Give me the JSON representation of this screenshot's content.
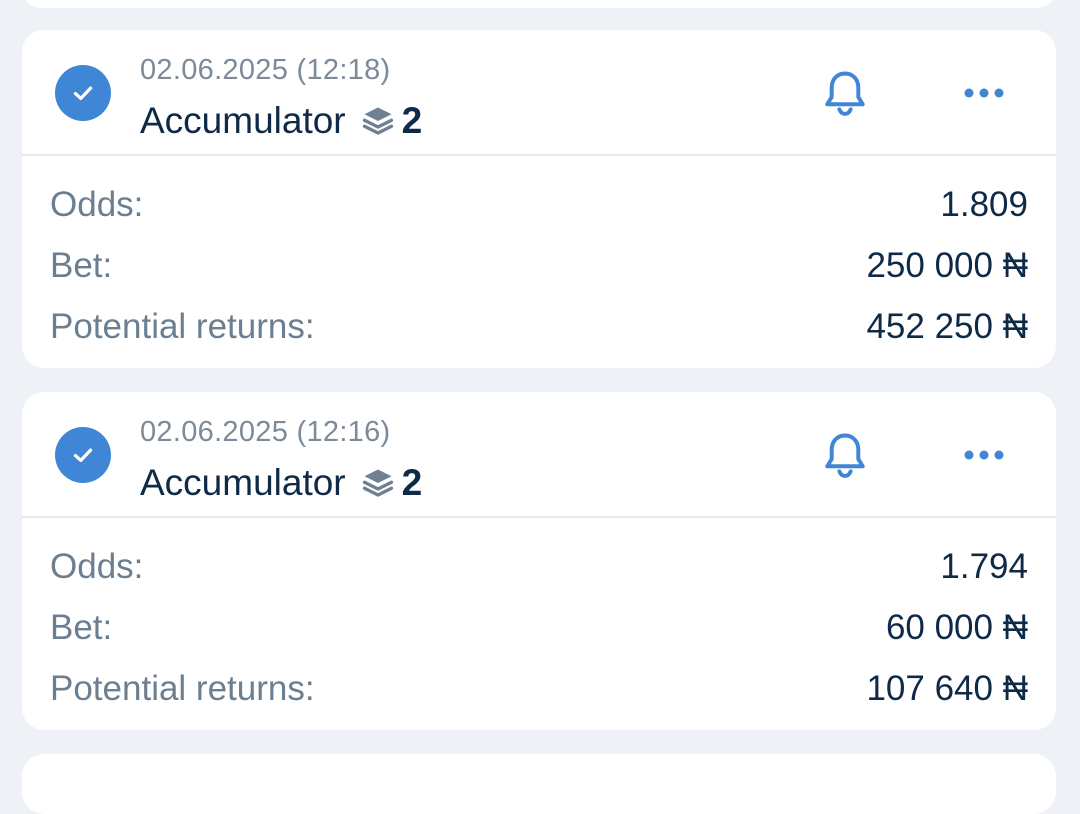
{
  "bets": [
    {
      "datetime": "02.06.2025 (12:18)",
      "type_label": "Accumulator",
      "selections_count": "2",
      "rows": {
        "odds_label": "Odds:",
        "odds_value": "1.809",
        "bet_label": "Bet:",
        "bet_value": "250 000 ₦",
        "returns_label": "Potential returns:",
        "returns_value": "452 250 ₦"
      }
    },
    {
      "datetime": "02.06.2025 (12:16)",
      "type_label": "Accumulator",
      "selections_count": "2",
      "rows": {
        "odds_label": "Odds:",
        "odds_value": "1.794",
        "bet_label": "Bet:",
        "bet_value": "60 000 ₦",
        "returns_label": "Potential returns:",
        "returns_value": "107 640 ₦"
      }
    }
  ],
  "icons": {
    "status": "check-circle-icon",
    "type": "layers-icon",
    "notify": "bell-icon",
    "menu": "more-dots-icon"
  },
  "colors": {
    "background": "#eef1f6",
    "card": "#ffffff",
    "accent": "#3f86d6",
    "text_primary": "#0e2a47",
    "text_secondary": "#6c7f91"
  }
}
